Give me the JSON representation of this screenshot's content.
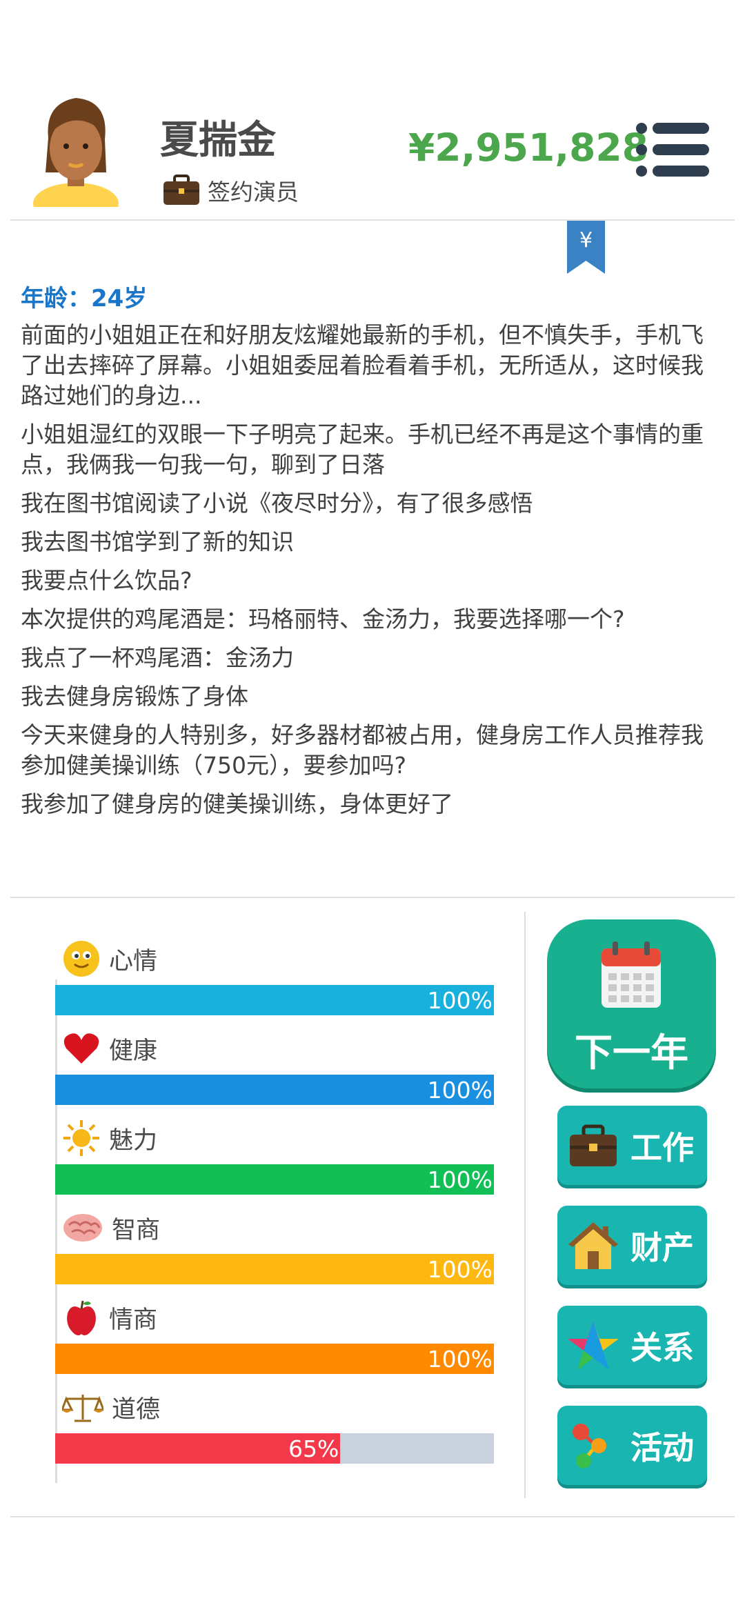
{
  "header": {
    "name": "夏揣金",
    "job": "签约演员",
    "money": "¥2,951,828"
  },
  "bookmark": {
    "symbol": "¥"
  },
  "log": {
    "age": "年龄：24岁",
    "entries": [
      "前面的小姐姐正在和好朋友炫耀她最新的手机，但不慎失手，手机飞了出去摔碎了屏幕。小姐姐委屈着脸看着手机，无所适从，这时候我路过她们的身边...",
      "小姐姐湿红的双眼一下子明亮了起来。手机已经不再是这个事情的重点，我俩我一句我一句，聊到了日落",
      "我在图书馆阅读了小说《夜尽时分》，有了很多感悟",
      "我去图书馆学到了新的知识",
      "我要点什么饮品?",
      "本次提供的鸡尾酒是：玛格丽特、金汤力，我要选择哪一个?",
      "我点了一杯鸡尾酒：金汤力",
      "我去健身房锻炼了身体",
      "今天来健身的人特别多，好多器材都被占用，健身房工作人员推荐我参加健美操训练（750元），要参加吗?",
      "我参加了健身房的健美操训练，身体更好了"
    ]
  },
  "stats": [
    {
      "label": "心情",
      "value": 100,
      "text": "100%",
      "color": "#1ab0dd",
      "icon": "smiley-icon"
    },
    {
      "label": "健康",
      "value": 100,
      "text": "100%",
      "color": "#1a8fe0",
      "icon": "heart-icon"
    },
    {
      "label": "魅力",
      "value": 100,
      "text": "100%",
      "color": "#12be56",
      "icon": "sun-icon"
    },
    {
      "label": "智商",
      "value": 100,
      "text": "100%",
      "color": "#ffb811",
      "icon": "brain-icon"
    },
    {
      "label": "情商",
      "value": 100,
      "text": "100%",
      "color": "#ff8a00",
      "icon": "apple-icon"
    },
    {
      "label": "道德",
      "value": 65,
      "text": "65%",
      "color": "#f23849",
      "icon": "scales-icon"
    }
  ],
  "buttons": {
    "next_year": "下一年",
    "work": "工作",
    "property": "财产",
    "relations": "关系",
    "activity": "活动"
  }
}
